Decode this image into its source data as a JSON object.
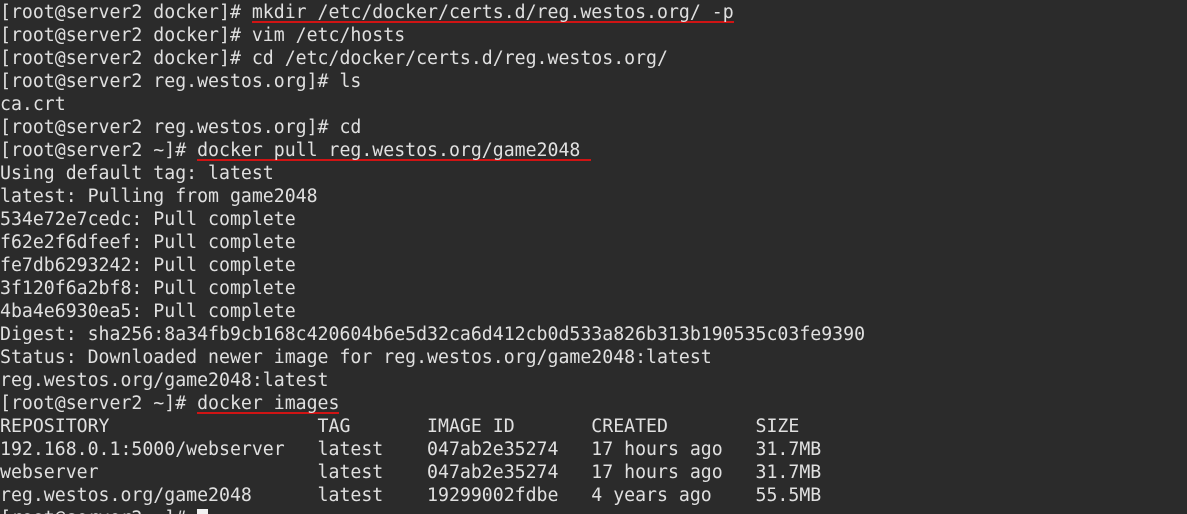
{
  "terminal": {
    "background": "#2b2b2b",
    "foreground": "#e0e0e0",
    "underline_color": "#d01414",
    "lines": [
      {
        "kind": "cmd",
        "prompt": "[root@server2 docker]# ",
        "text": "mkdir /etc/docker/certs.d/reg.westos.org/ -p",
        "underlined": true
      },
      {
        "kind": "cmd",
        "prompt": "[root@server2 docker]# ",
        "text": "vim /etc/hosts",
        "underlined": false
      },
      {
        "kind": "cmd",
        "prompt": "[root@server2 docker]# ",
        "text": "cd /etc/docker/certs.d/reg.westos.org/",
        "underlined": false
      },
      {
        "kind": "cmd",
        "prompt": "[root@server2 reg.westos.org]# ",
        "text": "ls",
        "underlined": false
      },
      {
        "kind": "out",
        "text": "ca.crt"
      },
      {
        "kind": "cmd",
        "prompt": "[root@server2 reg.westos.org]# ",
        "text": "cd",
        "underlined": false
      },
      {
        "kind": "cmd",
        "prompt": "[root@server2 ~]# ",
        "text": "docker pull reg.westos.org/game2048 ",
        "underlined": true
      },
      {
        "kind": "out",
        "text": "Using default tag: latest"
      },
      {
        "kind": "out",
        "text": "latest: Pulling from game2048"
      },
      {
        "kind": "out",
        "text": "534e72e7cedc: Pull complete"
      },
      {
        "kind": "out",
        "text": "f62e2f6dfeef: Pull complete"
      },
      {
        "kind": "out",
        "text": "fe7db6293242: Pull complete"
      },
      {
        "kind": "out",
        "text": "3f120f6a2bf8: Pull complete"
      },
      {
        "kind": "out",
        "text": "4ba4e6930ea5: Pull complete"
      },
      {
        "kind": "out",
        "text": "Digest: sha256:8a34fb9cb168c420604b6e5d32ca6d412cb0d533a826b313b190535c03fe9390"
      },
      {
        "kind": "out",
        "text": "Status: Downloaded newer image for reg.westos.org/game2048:latest"
      },
      {
        "kind": "out",
        "text": "reg.westos.org/game2048:latest"
      },
      {
        "kind": "cmd",
        "prompt": "[root@server2 ~]# ",
        "text": "docker images",
        "underlined": true
      },
      {
        "kind": "out",
        "text": "REPOSITORY                   TAG       IMAGE ID       CREATED        SIZE"
      },
      {
        "kind": "out",
        "text": "192.168.0.1:5000/webserver   latest    047ab2e35274   17 hours ago   31.7MB"
      },
      {
        "kind": "out",
        "text": "webserver                    latest    047ab2e35274   17 hours ago   31.7MB"
      },
      {
        "kind": "out",
        "text": "reg.westos.org/game2048      latest    19299002fdbe   4 years ago    55.5MB"
      },
      {
        "kind": "cmd",
        "prompt": "[root@server2 ~]# ",
        "text": "",
        "underlined": false,
        "cursor": true
      }
    ]
  }
}
